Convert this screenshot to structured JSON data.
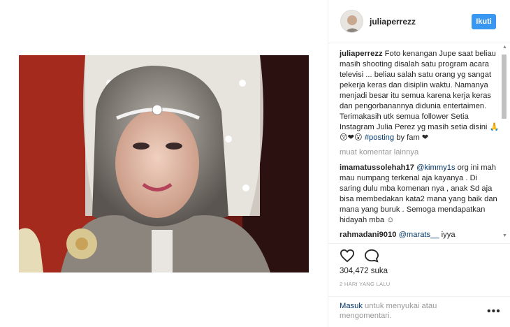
{
  "post": {
    "username": "juliaperrezz",
    "follow_label": "Ikuti",
    "caption_user": "juliaperrezz",
    "caption_text": " Foto kenangan Jupe saat beliau masih shooting disalah satu program acara televisi ... beliau salah satu orang yg sangat pekerja keras dan disiplin waktu. Namanya menjadi besar itu semua karena kerja keras dan pengorbanannya didunia entertaimen. Terimakasih utk semua follower Setia Instagram Julia Perez yg masih setia disini 🙏😚❤😮 ",
    "caption_tag": "#posting",
    "caption_end": " by fam ❤",
    "more_comments": "muat komentar lainnya",
    "comments": [
      {
        "user": "imamatussolehah17",
        "mention": "@kimmy1s",
        "text": " org ini mah mau numpang terkenal aja kayanya . Di saring dulu mba komenan nya , anak Sd aja bisa membedakan kata2 mana yang baik dan mana yang buruk . Semoga mendapatkan hidayah mba ☺"
      },
      {
        "user": "rahmadani9010",
        "mention": "@marats__",
        "text": " iyya"
      }
    ],
    "likes": "304,472 suka",
    "time_ago": "2 HARI YANG LALU",
    "login_link": "Masuk",
    "login_text": " untuk menyukai atau mengomentari.",
    "more_options": "•••"
  },
  "icons": {
    "heart": "heart-icon",
    "comment": "comment-icon"
  }
}
